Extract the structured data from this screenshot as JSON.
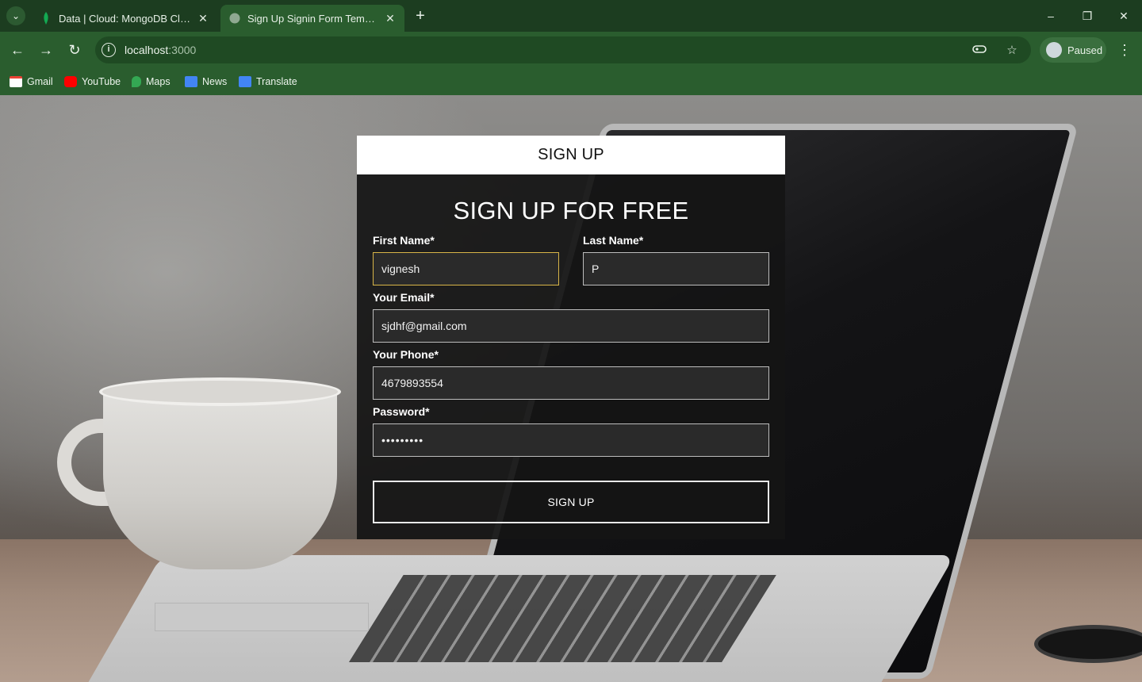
{
  "browser": {
    "tabs": [
      {
        "title": "Data | Cloud: MongoDB Cloud",
        "active": false,
        "icon": "mongodb-leaf-icon"
      },
      {
        "title": "Sign Up Signin Form Template I",
        "active": true,
        "icon": "globe-icon"
      }
    ],
    "address": {
      "host": "localhost",
      "port": ":3000"
    },
    "profile": {
      "label": "Paused"
    },
    "bookmarks": [
      {
        "label": "Gmail",
        "icon": "gmail-icon",
        "color": "#ea4335"
      },
      {
        "label": "YouTube",
        "icon": "youtube-icon",
        "color": "#ff0000"
      },
      {
        "label": "Maps",
        "icon": "maps-icon",
        "color": "#34a853"
      },
      {
        "label": "News",
        "icon": "news-icon",
        "color": "#4285f4"
      },
      {
        "label": "Translate",
        "icon": "translate-icon",
        "color": "#4285f4"
      }
    ],
    "colors": {
      "tabbar": "#1c3d20",
      "toolbar": "#2a5d2e"
    }
  },
  "form": {
    "header_label": "SIGN UP",
    "title": "SIGN UP FOR FREE",
    "first_name": {
      "label": "First Name*",
      "value": "vignesh"
    },
    "last_name": {
      "label": "Last Name*",
      "value": "P"
    },
    "email": {
      "label": "Your Email*",
      "value": "sjdhf@gmail.com"
    },
    "phone": {
      "label": "Your Phone*",
      "value": "4679893554"
    },
    "password": {
      "label": "Password*",
      "value": "•••••••••"
    },
    "submit_label": "SIGN UP",
    "colors": {
      "focus_border": "#d8b548",
      "card": "#141414"
    }
  }
}
